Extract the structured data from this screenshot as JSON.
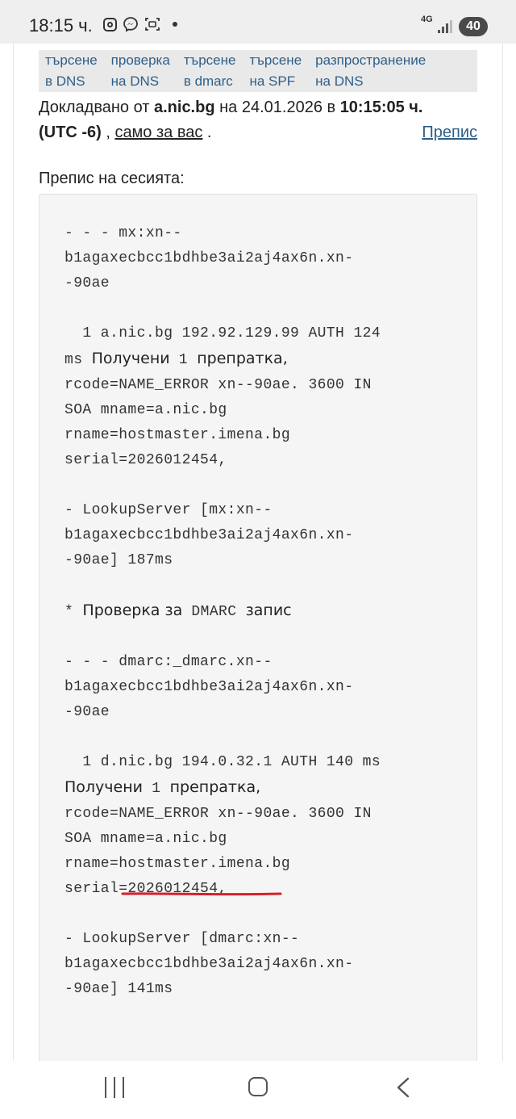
{
  "status_bar": {
    "time": "18:15 ч.",
    "network": "4G",
    "battery": "40",
    "icons": [
      "instagram-icon",
      "messenger-icon",
      "screenshot-icon",
      "dot-icon",
      "signal-icon"
    ]
  },
  "nav_links": [
    {
      "label": "търсене\nв DNS"
    },
    {
      "label": "проверка\nна DNS"
    },
    {
      "label": "търсене\nв dmarc"
    },
    {
      "label": "търсене\nна SPF"
    },
    {
      "label": "разпространение\nна DNS"
    }
  ],
  "report": {
    "prefix": "Докладвано от ",
    "server": "a.nic.bg",
    "on": " на 24.01.2026 в ",
    "time": "10:15:05 ч.",
    "tz": "(UTC -6)",
    "sep": " , ",
    "only_you": "само за вас",
    "end": " .",
    "transcript_link": "Препис"
  },
  "session": {
    "title": "Препис на сесията:"
  },
  "transcript": {
    "l1": "- - - mx:xn--",
    "l2": "b1agaxecbcc1bdhbe3ai2aj4ax6n.xn-",
    "l3": "-90ae",
    "l4": "  1 a.nic.bg 192.92.129.99 AUTH 124",
    "l5a": "ms ",
    "l5b": "Получени",
    "l5c": " 1 ",
    "l5d": "препратка,",
    "l6": "rcode=NAME_ERROR xn--90ae. 3600 IN",
    "l7": "SOA mname=a.nic.bg",
    "l8": "rname=hostmaster.imena.bg",
    "l9": "serial=2026012454,",
    "l10": "- LookupServer [mx:xn--",
    "l11": "b1agaxecbcc1bdhbe3ai2aj4ax6n.xn-",
    "l12": "-90ae] 187ms",
    "l13a": "* ",
    "l13b": "Проверка за",
    "l13c": " DMARC ",
    "l13d": "запис",
    "l14": "- - - dmarc:_dmarc.xn--",
    "l15": "b1agaxecbcc1bdhbe3ai2aj4ax6n.xn-",
    "l16": "-90ae",
    "l17": "  1 d.nic.bg 194.0.32.1 AUTH 140 ms",
    "l18a": "Получени",
    "l18b": " 1 ",
    "l18c": "препратка,",
    "l19": "rcode=NAME_ERROR xn--90ae. 3600 IN",
    "l20": "SOA mname=a.nic.bg",
    "l21": "rname=hostmaster.imena.bg",
    "l22": "serial=2026012454,",
    "l23": "- LookupServer [dmarc:xn--",
    "l24": "b1agaxecbcc1bdhbe3ai2aj4ax6n.xn-",
    "l25": "-90ae] 141ms"
  },
  "colors": {
    "link": "#2e5f8a",
    "highlight": "#d6202a",
    "code_bg": "#f5f5f5"
  }
}
